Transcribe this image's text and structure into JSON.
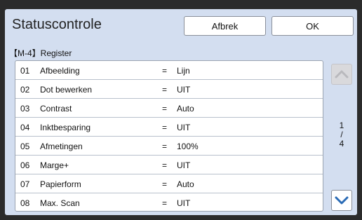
{
  "header": {
    "title": "Statuscontrole",
    "cancel_label": "Afbrek",
    "ok_label": "OK"
  },
  "section": {
    "label": "【M-4】Register"
  },
  "rows": [
    {
      "num": "01",
      "name": "Afbeelding",
      "eq": "=",
      "value": "Lijn"
    },
    {
      "num": "02",
      "name": "Dot  bewerken",
      "eq": "=",
      "value": "UIT"
    },
    {
      "num": "03",
      "name": "Contrast",
      "eq": "=",
      "value": "Auto"
    },
    {
      "num": "04",
      "name": "Inktbesparing",
      "eq": "=",
      "value": "UIT"
    },
    {
      "num": "05",
      "name": "Afmetingen",
      "eq": "=",
      "value": "100%"
    },
    {
      "num": "06",
      "name": "Marge+",
      "eq": "=",
      "value": "UIT"
    },
    {
      "num": "07",
      "name": "Papierform",
      "eq": "=",
      "value": "Auto"
    },
    {
      "num": "08",
      "name": "Max. Scan",
      "eq": "=",
      "value": "UIT"
    }
  ],
  "pager": {
    "current": "1",
    "separator": "/",
    "total": "4"
  },
  "icons": {
    "scroll_up": "chevron-up-icon",
    "scroll_down": "chevron-down-icon"
  },
  "colors": {
    "panel_bg": "#d3def0",
    "accent_blue": "#2a6bb5",
    "disabled_gray": "#b9b9bd"
  }
}
